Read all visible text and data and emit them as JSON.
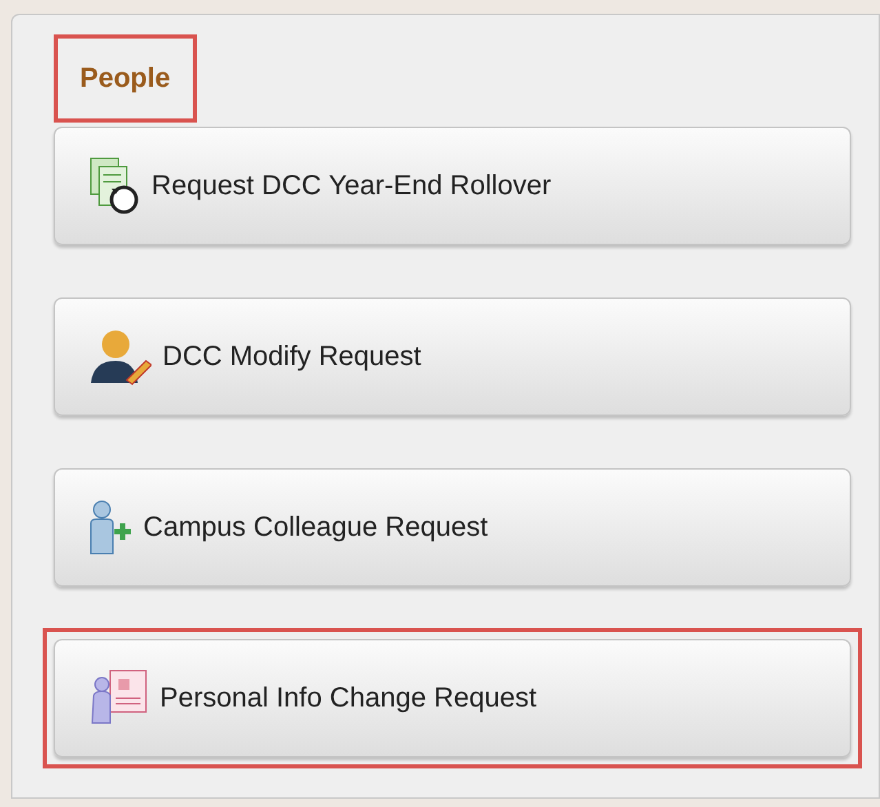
{
  "section": {
    "title": "People",
    "highlighted": true
  },
  "tiles": [
    {
      "label": "Request DCC Year-End Rollover",
      "kind": "rollover",
      "highlighted": false
    },
    {
      "label": "DCC Modify Request",
      "kind": "person-edit",
      "highlighted": false
    },
    {
      "label": "Campus Colleague Request",
      "kind": "person-add",
      "highlighted": false
    },
    {
      "label": "Personal Info Change Request",
      "kind": "person-card",
      "highlighted": true
    }
  ]
}
